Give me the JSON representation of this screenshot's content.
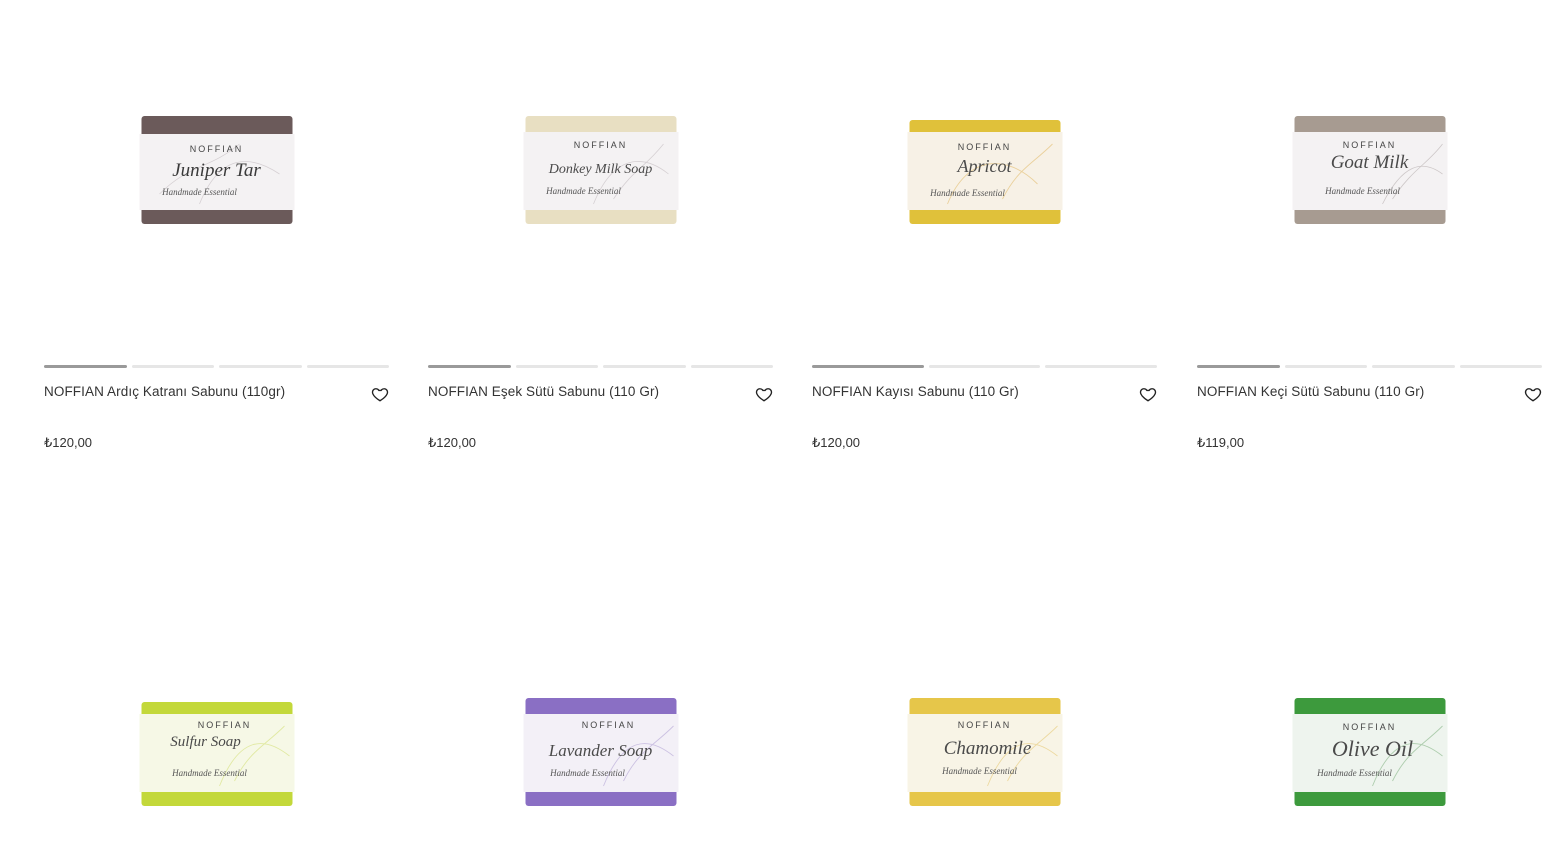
{
  "colors": {
    "dot_active": "#9a9a9a",
    "dot_inactive": "#e6e6e6",
    "text": "#333333"
  },
  "products": [
    {
      "title": "NOFFIAN Ardıç Katranı Sabunu (110gr)",
      "price": "₺120,00",
      "brand": "NOFFIAN",
      "label": "Juniper Tar",
      "sub": "Handmade Essential",
      "soap_color": "#6b5a5a",
      "slides": 4,
      "active_slide": 1
    },
    {
      "title": "NOFFIAN Eşek Sütü Sabunu (110 Gr)",
      "price": "₺120,00",
      "brand": "NOFFIAN",
      "label": "Donkey Milk Soap",
      "sub": "Handmade Essential",
      "soap_color": "#e8dfc2",
      "slides": 4,
      "active_slide": 1
    },
    {
      "title": "NOFFIAN Kayısı Sabunu (110 Gr)",
      "price": "₺120,00",
      "brand": "NOFFIAN",
      "label": "Apricot",
      "sub": "Handmade Essential",
      "soap_color": "#e0c13a",
      "slides": 3,
      "active_slide": 1
    },
    {
      "title": "NOFFIAN Keçi Sütü Sabunu (110 Gr)",
      "price": "₺119,00",
      "brand": "NOFFIAN",
      "label": "Goat Milk",
      "sub": "Handmade Essential",
      "soap_color": "#a79b91",
      "slides": 4,
      "active_slide": 1
    }
  ],
  "products_row2": [
    {
      "brand": "NOFFIAN",
      "label": "Sulfur Soap",
      "sub": "Handmade Essential",
      "soap_color": "#c3d83a"
    },
    {
      "brand": "NOFFIAN",
      "label": "Lavander Soap",
      "sub": "Handmade Essential",
      "soap_color": "#8a6fc4"
    },
    {
      "brand": "NOFFIAN",
      "label": "Chamomile",
      "sub": "Handmade Essential",
      "soap_color": "#e6c64a"
    },
    {
      "brand": "NOFFIAN",
      "label": "Olive Oil",
      "sub": "Handmade Essential",
      "soap_color": "#3d9a3d"
    }
  ],
  "icons": {
    "favorite": "heart-outline-icon"
  }
}
